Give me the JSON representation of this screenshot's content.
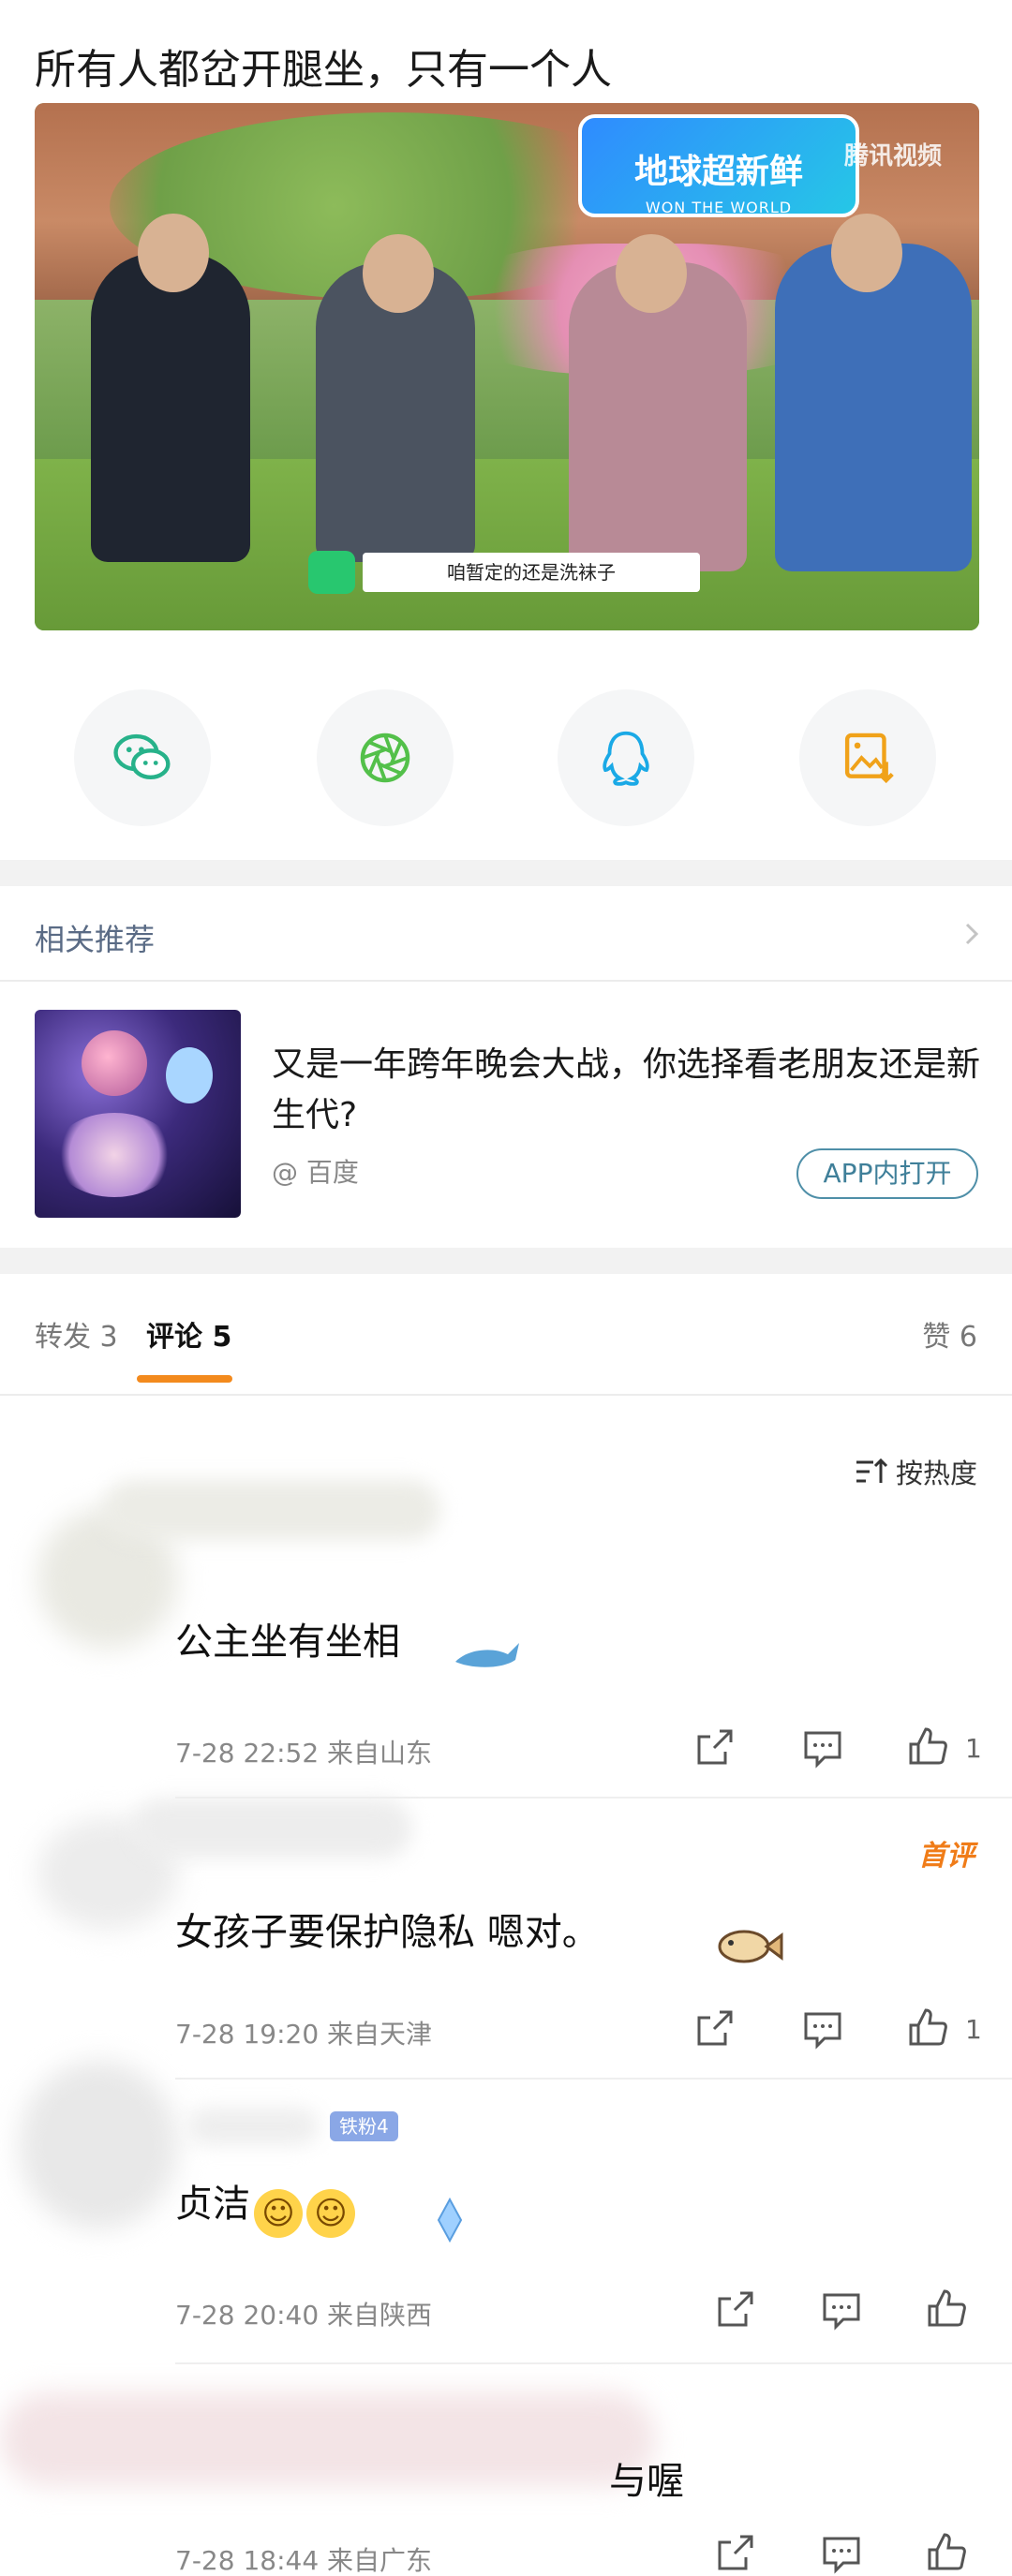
{
  "post": {
    "title": "所有人都岔开腿坐，只有一个人"
  },
  "video": {
    "show_logo": "地球超新鲜",
    "show_logo_sub": "WON THE WORLD",
    "watermark": "腾讯视频",
    "subtitle": "咱暂定的还是洗袜子"
  },
  "share": {
    "items": [
      {
        "icon": "wechat-icon",
        "color": "#27b28a"
      },
      {
        "icon": "moments-icon",
        "color": "#53c04a"
      },
      {
        "icon": "qq-icon",
        "color": "#1aa9e6"
      },
      {
        "icon": "save-image-icon",
        "color": "#f0a21a"
      }
    ]
  },
  "related": {
    "title": "相关推荐",
    "item": {
      "headline": "又是一年跨年晚会大战，你选择看老朋友还是新生代?",
      "source": "@ 百度",
      "open_label": "APP内打开"
    }
  },
  "tabs": {
    "repost": "转发 3",
    "comment": "评论 5",
    "like": "赞 6"
  },
  "sort_label": "按热度",
  "comments": [
    {
      "text": "公主坐有坐相",
      "meta": "7-28 22:52  来自山东",
      "likes": "1"
    },
    {
      "text": "女孩子要保护隐私  嗯对。",
      "meta": "7-28 19:20  来自天津",
      "likes": "1",
      "badge": "首评"
    },
    {
      "text": "贞洁",
      "meta": "7-28 20:40  来自陕西",
      "likes": "",
      "fan_badge": "铁粉4"
    },
    {
      "text": "与喔",
      "meta": "7-28 18:44  来自广东",
      "likes": ""
    }
  ],
  "colors": {
    "accent": "#f38a1d",
    "link": "#5a6b85",
    "badge_orange": "#f07c18"
  }
}
